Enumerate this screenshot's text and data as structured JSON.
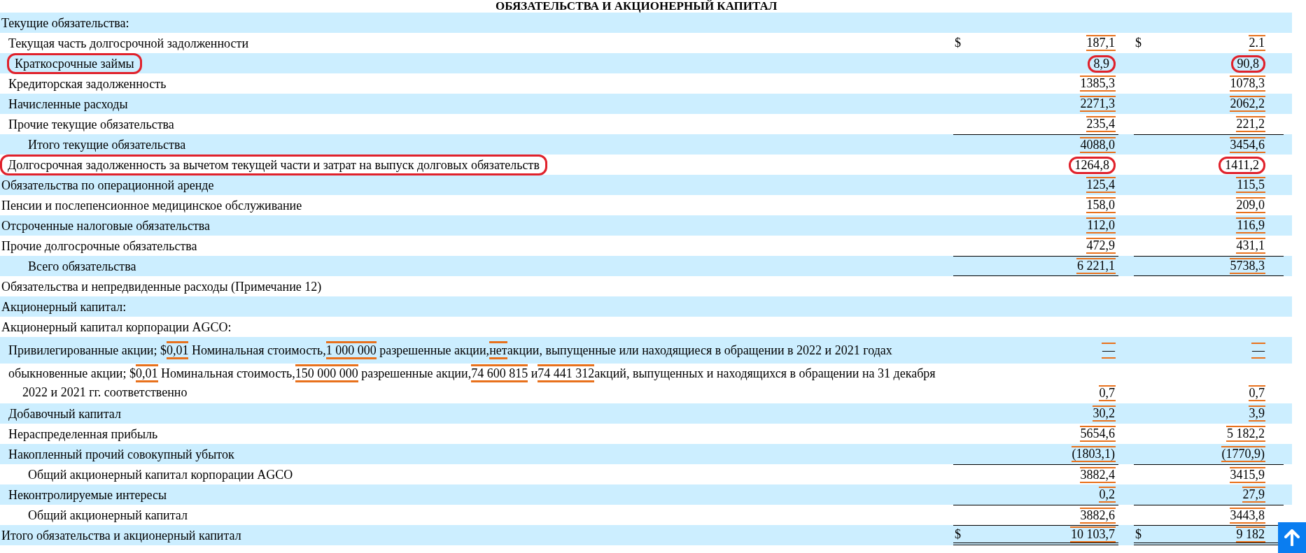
{
  "title": "ОБЯЗАТЕЛЬСТВА И АКЦИОНЕРНЫЙ КАПИТАЛ",
  "rows": [
    {
      "kind": "section",
      "label": "Текущие обязательства:"
    },
    {
      "kind": "item",
      "label": "Текущая часть долгосрочной задолженности",
      "currency": "$",
      "values": [
        "187,1",
        "2.1"
      ]
    },
    {
      "kind": "item",
      "label": "Краткосрочные займы",
      "values": [
        "8,9",
        "90,8"
      ],
      "circled": true
    },
    {
      "kind": "item",
      "label": "Кредиторская задолженность",
      "values": [
        "1385,3",
        "1078,3"
      ]
    },
    {
      "kind": "item",
      "label": "Начисленные расходы",
      "values": [
        "2271,3",
        "2062,2"
      ]
    },
    {
      "kind": "item",
      "label": "Прочие текущие обязательства",
      "values": [
        "235,4",
        "221,2"
      ]
    },
    {
      "kind": "total",
      "label": "Итого текущие обязательства",
      "values": [
        "4088,0",
        "3454,6"
      ],
      "rule_above": true
    },
    {
      "kind": "section",
      "label": "Долгосрочная задолженность за вычетом текущей части и затрат на выпуск долговых обязательств",
      "values": [
        "1264,8",
        "1411,2"
      ],
      "circled": true
    },
    {
      "kind": "section",
      "label": "Обязательства по операционной аренде",
      "values": [
        "125,4",
        "115,5"
      ]
    },
    {
      "kind": "section",
      "label": "Пенсии и послепенсионное медицинское обслуживание",
      "values": [
        "158,0",
        "209,0"
      ]
    },
    {
      "kind": "section",
      "label": "Отсроченные налоговые обязательства",
      "values": [
        "112,0",
        "116,9"
      ]
    },
    {
      "kind": "section",
      "label": "Прочие долгосрочные обязательства",
      "values": [
        "472,9",
        "431,1"
      ]
    },
    {
      "kind": "total",
      "label": "Всего обязательства",
      "values": [
        "6 221,1",
        "5738,3"
      ],
      "rule_above": true,
      "rule_below": true
    },
    {
      "kind": "section",
      "label": "Обязательства и непредвиденные расходы (Примечание 12)"
    },
    {
      "kind": "section",
      "label": "Акционерный капитал:"
    },
    {
      "kind": "section",
      "label": "Акционерный капитал корпорации AGCO:"
    },
    {
      "kind": "description",
      "segments": [
        {
          "text": "Привилегированные акции; $",
          "tagged": false
        },
        {
          "text": "0,01",
          "tagged": true
        },
        {
          "text": " Номинальная стоимость,",
          "tagged": false
        },
        {
          "text": "1 000 000",
          "tagged": true
        },
        {
          "text": " разрешенные акции,",
          "tagged": false
        },
        {
          "text": "нет",
          "tagged": true
        },
        {
          "text": "акции, выпущенные или находящиеся в обращении в 2022 и 2021 годах",
          "tagged": false
        }
      ],
      "values": [
        "—",
        "—"
      ]
    },
    {
      "kind": "description",
      "segments": [
        {
          "text": "обыкновенные акции; $",
          "tagged": false
        },
        {
          "text": "0,01",
          "tagged": true
        },
        {
          "text": " Номинальная стоимость,",
          "tagged": false
        },
        {
          "text": "150 000 000",
          "tagged": true
        },
        {
          "text": " разрешенные акции,",
          "tagged": false
        },
        {
          "text": "74 600 815",
          "tagged": true
        },
        {
          "text": " и",
          "tagged": false
        },
        {
          "text": "74 441 312",
          "tagged": true
        },
        {
          "text": "акций, выпущенных и находящихся в обращении на 31 декабря 2022 и 2021 гг. соответственно",
          "tagged": false
        }
      ],
      "values": [
        "0,7",
        "0,7"
      ]
    },
    {
      "kind": "item",
      "label": "Добавочный капитал",
      "values": [
        "30,2",
        "3,9"
      ]
    },
    {
      "kind": "item",
      "label": "Нераспределенная прибыль",
      "values": [
        "5654,6",
        "5 182,2"
      ]
    },
    {
      "kind": "item",
      "label": "Накопленный прочий совокупный убыток",
      "values": [
        "(1803,1)",
        "(1770,9)"
      ]
    },
    {
      "kind": "total",
      "label": "Общий акционерный капитал корпорации AGCO",
      "values": [
        "3882,4",
        "3415,9"
      ],
      "rule_above": true
    },
    {
      "kind": "item",
      "label": "Неконтролируемые интересы",
      "values": [
        "0,2",
        "27,9"
      ]
    },
    {
      "kind": "total",
      "label": "Общий акционерный капитал",
      "values": [
        "3882,6",
        "3443,8"
      ],
      "rule_above": true
    },
    {
      "kind": "section",
      "label": "Итого обязательства и акционерный капитал",
      "currency": "$",
      "values": [
        "10 103,7",
        "9 182"
      ],
      "rule_above": true,
      "double_rule_below": true
    }
  ]
}
